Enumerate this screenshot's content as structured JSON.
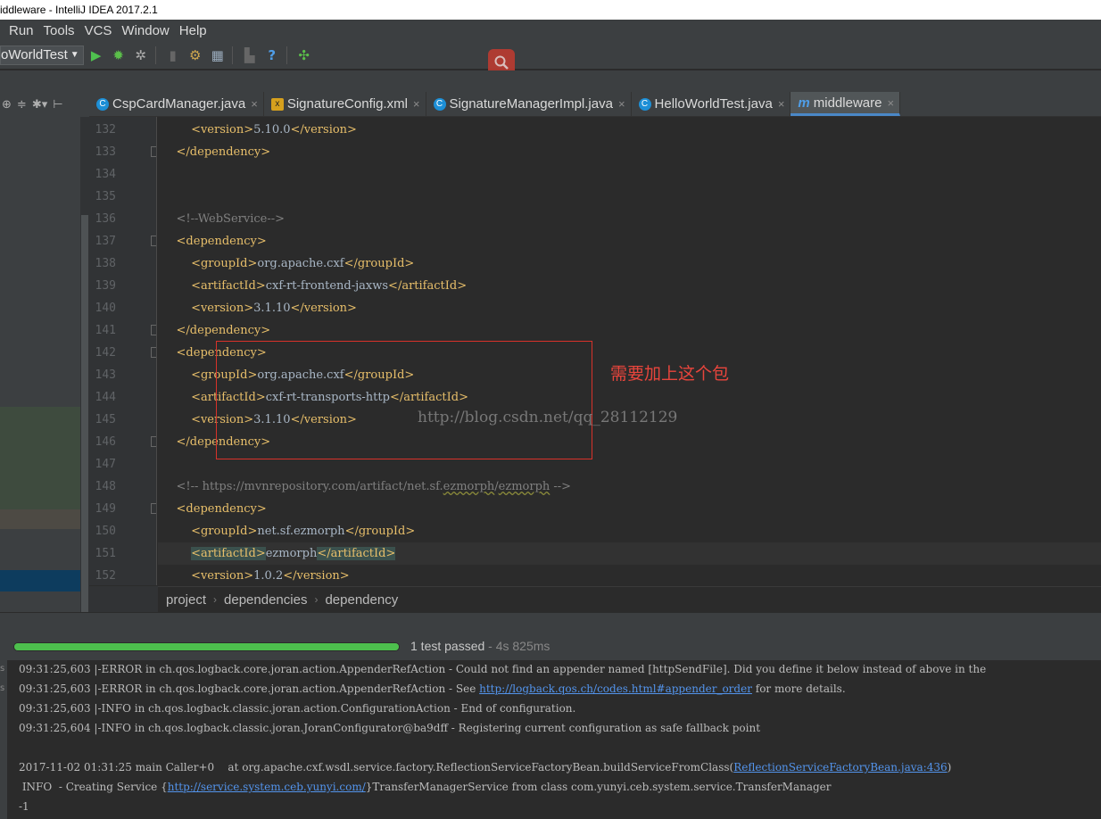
{
  "window": {
    "title": "iddleware - IntelliJ IDEA 2017.2.1"
  },
  "menu": [
    "Run",
    "Tools",
    "VCS",
    "Window",
    "Help"
  ],
  "toolbar": {
    "run_config": "oWorldTest"
  },
  "tabs": [
    {
      "label": "CspCardManager.java",
      "icon": "java-class-icon",
      "active": false
    },
    {
      "label": "SignatureConfig.xml",
      "icon": "xml-file-icon",
      "active": false
    },
    {
      "label": "SignatureManagerImpl.java",
      "icon": "java-class-icon",
      "active": false
    },
    {
      "label": "HelloWorldTest.java",
      "icon": "java-test-icon",
      "active": false
    },
    {
      "label": "middleware",
      "icon": "maven-icon",
      "active": true
    }
  ],
  "editor": {
    "lines": [
      {
        "num": "132",
        "parts": [
          [
            "txt",
            "        "
          ],
          [
            "tag",
            "<version>"
          ],
          [
            "txt",
            "5.10.0"
          ],
          [
            "tag",
            "</version>"
          ]
        ]
      },
      {
        "num": "133",
        "parts": [
          [
            "txt",
            "    "
          ],
          [
            "tag",
            "</dependency>"
          ]
        ]
      },
      {
        "num": "134",
        "parts": []
      },
      {
        "num": "135",
        "parts": []
      },
      {
        "num": "136",
        "parts": [
          [
            "txt",
            "    "
          ],
          [
            "cmt",
            "<!--WebService-->"
          ]
        ]
      },
      {
        "num": "137",
        "parts": [
          [
            "txt",
            "    "
          ],
          [
            "tag",
            "<dependency>"
          ]
        ]
      },
      {
        "num": "138",
        "parts": [
          [
            "txt",
            "        "
          ],
          [
            "tag",
            "<groupId>"
          ],
          [
            "txt",
            "org.apache.cxf"
          ],
          [
            "tag",
            "</groupId>"
          ]
        ]
      },
      {
        "num": "139",
        "parts": [
          [
            "txt",
            "        "
          ],
          [
            "tag",
            "<artifactId>"
          ],
          [
            "txt",
            "cxf-rt-frontend-jaxws"
          ],
          [
            "tag",
            "</artifactId>"
          ]
        ]
      },
      {
        "num": "140",
        "parts": [
          [
            "txt",
            "        "
          ],
          [
            "tag",
            "<version>"
          ],
          [
            "txt",
            "3.1.10"
          ],
          [
            "tag",
            "</version>"
          ]
        ]
      },
      {
        "num": "141",
        "parts": [
          [
            "txt",
            "    "
          ],
          [
            "tag",
            "</dependency>"
          ]
        ]
      },
      {
        "num": "142",
        "parts": [
          [
            "txt",
            "    "
          ],
          [
            "tag",
            "<dependency>"
          ]
        ]
      },
      {
        "num": "143",
        "parts": [
          [
            "txt",
            "        "
          ],
          [
            "tag",
            "<groupId>"
          ],
          [
            "txt",
            "org.apache.cxf"
          ],
          [
            "tag",
            "</groupId>"
          ]
        ]
      },
      {
        "num": "144",
        "parts": [
          [
            "txt",
            "        "
          ],
          [
            "tag",
            "<artifactId>"
          ],
          [
            "txt",
            "cxf-rt-transports-http"
          ],
          [
            "tag",
            "</artifactId>"
          ]
        ]
      },
      {
        "num": "145",
        "parts": [
          [
            "txt",
            "        "
          ],
          [
            "tag",
            "<version>"
          ],
          [
            "txt",
            "3.1.10"
          ],
          [
            "tag",
            "</version>"
          ]
        ]
      },
      {
        "num": "146",
        "parts": [
          [
            "txt",
            "    "
          ],
          [
            "tag",
            "</dependency>"
          ]
        ]
      },
      {
        "num": "147",
        "parts": []
      },
      {
        "num": "148",
        "parts": [
          [
            "txt",
            "    "
          ],
          [
            "cmt",
            "<!-- https://mvnrepository.com/artifact/net.sf."
          ],
          [
            "cmtsq",
            "ezmorph"
          ],
          [
            "cmt",
            "/"
          ],
          [
            "cmtsq",
            "ezmorph"
          ],
          [
            "cmt",
            " -->"
          ]
        ]
      },
      {
        "num": "149",
        "parts": [
          [
            "txt",
            "    "
          ],
          [
            "tag",
            "<dependency>"
          ]
        ]
      },
      {
        "num": "150",
        "parts": [
          [
            "txt",
            "        "
          ],
          [
            "tag",
            "<groupId>"
          ],
          [
            "txt",
            "net.sf.ezmorph"
          ],
          [
            "tag",
            "</groupId>"
          ]
        ]
      },
      {
        "num": "151",
        "parts": [
          [
            "txt",
            "        "
          ],
          [
            "taghl",
            "<artifactId>"
          ],
          [
            "txt",
            "ezmorph"
          ],
          [
            "taghl",
            "</artifactId>"
          ]
        ]
      },
      {
        "num": "152",
        "parts": [
          [
            "txt",
            "        "
          ],
          [
            "tag",
            "<version>"
          ],
          [
            "txt",
            "1.0.2"
          ],
          [
            "tag",
            "</version>"
          ]
        ]
      }
    ],
    "annotation": "需要加上这个包",
    "watermark": "http://blog.csdn.net/qq_28112129"
  },
  "breadcrumb": [
    "project",
    "dependencies",
    "dependency"
  ],
  "run": {
    "status": "1 test passed",
    "duration": " - 4s 825ms",
    "progress": 1.0
  },
  "console": [
    [
      [
        "t",
        "09:31:25,603 |-ERROR in ch.qos.logback.core.joran.action.AppenderRefAction - Could not find an appender named [httpSendFile]. Did you define it below instead of above in the"
      ]
    ],
    [
      [
        "t",
        "09:31:25,603 |-ERROR in ch.qos.logback.core.joran.action.AppenderRefAction - See "
      ],
      [
        "l",
        "http://logback.qos.ch/codes.html#appender_order"
      ],
      [
        "t",
        " for more details."
      ]
    ],
    [
      [
        "t",
        "09:31:25,603 |-INFO in ch.qos.logback.classic.joran.action.ConfigurationAction - End of configuration."
      ]
    ],
    [
      [
        "t",
        "09:31:25,604 |-INFO in ch.qos.logback.classic.joran.JoranConfigurator@ba9dff - Registering current configuration as safe fallback point"
      ]
    ],
    [],
    [
      [
        "t",
        "2017-11-02 01:31:25 main Caller+0    at org.apache.cxf.wsdl.service.factory.ReflectionServiceFactoryBean.buildServiceFromClass("
      ],
      [
        "l",
        "ReflectionServiceFactoryBean.java:436"
      ],
      [
        "t",
        ")"
      ]
    ],
    [
      [
        "t",
        " INFO  - Creating Service {"
      ],
      [
        "l",
        "http://service.system.ceb.yunyi.com/"
      ],
      [
        "t",
        "}TransferManagerService from class com.yunyi.ceb.system.service.TransferManager"
      ]
    ],
    [
      [
        "t",
        "-1"
      ]
    ]
  ]
}
